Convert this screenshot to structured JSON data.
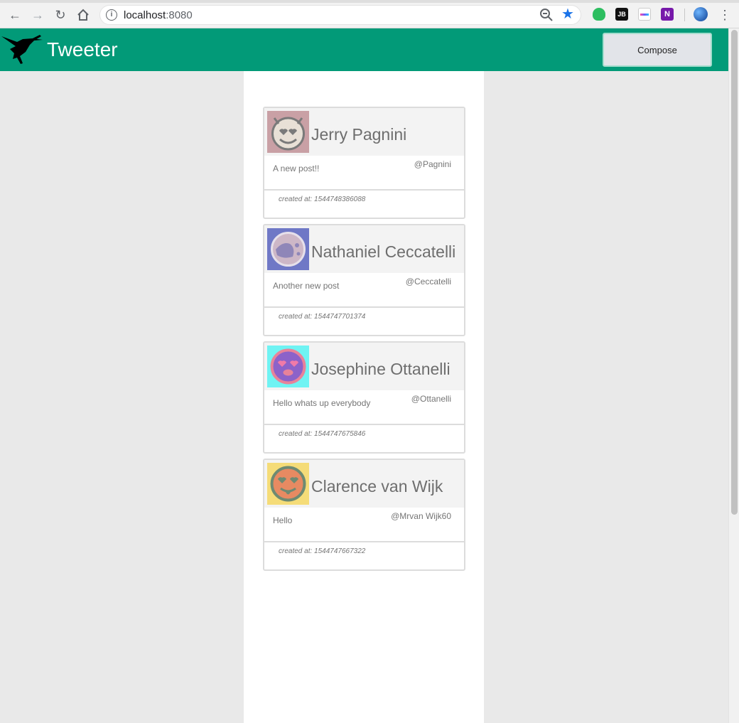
{
  "browser": {
    "url_host": "localhost",
    "url_port": ":8080",
    "ext_jb": "JB",
    "ext_onenote": "N"
  },
  "header": {
    "title": "Tweeter",
    "compose_label": "Compose"
  },
  "tweets": [
    {
      "name": "Jerry Pagnini",
      "handle": "@Pagnini",
      "text": "A new post!!",
      "created": "created at: 1544748386088",
      "avatar_bg": "#c9a0a5",
      "avatar_face": "#e8e0d6",
      "avatar_icon": "heart-eyes-devil-icon"
    },
    {
      "name": "Nathaniel Ceccatelli",
      "handle": "@Ceccatelli",
      "text": "Another new post",
      "created": "created at: 1544747701374",
      "avatar_bg": "#6f78c6",
      "avatar_face": "#cdb7c7",
      "avatar_icon": "alien-face-icon"
    },
    {
      "name": "Josephine Ottanelli",
      "handle": "@Ottanelli",
      "text": "Hello whats up everybody",
      "created": "created at: 1544747675846",
      "avatar_bg": "#6ff3f3",
      "avatar_face": "#d06fc8",
      "avatar_icon": "heart-eyes-face-icon"
    },
    {
      "name": "Clarence van Wijk",
      "handle": "@Mrvan Wijk60",
      "text": "Hello",
      "created": "created at: 1544747667322",
      "avatar_bg": "#f5dc78",
      "avatar_face": "#e78a62",
      "avatar_icon": "heart-eyes-tongue-icon"
    }
  ],
  "colors": {
    "header_bg": "#029a78",
    "page_bg": "#e9e9e9",
    "feed_bg": "#ffffff",
    "card_head_bg": "#f3f3f3",
    "text_muted": "#757575"
  }
}
